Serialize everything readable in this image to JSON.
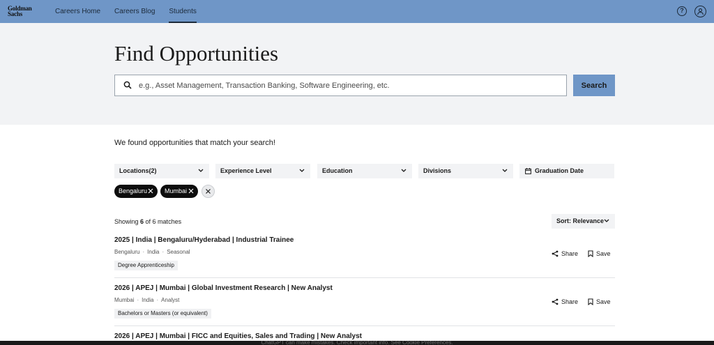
{
  "nav": {
    "logo_line1": "Goldman",
    "logo_line2": "Sachs",
    "links": [
      {
        "label": "Careers Home"
      },
      {
        "label": "Careers Blog"
      },
      {
        "label": "Students"
      }
    ],
    "help_glyph": "?"
  },
  "hero": {
    "title": "Find Opportunities",
    "search_placeholder": "e.g., Asset Management, Transaction Banking, Software Engineering, etc.",
    "search_value": "",
    "search_button": "Search"
  },
  "results": {
    "message": "We found opportunities that match your search!",
    "filters": [
      {
        "label": "Locations(2)"
      },
      {
        "label": "Experience Level"
      },
      {
        "label": "Education"
      },
      {
        "label": "Divisions"
      },
      {
        "label": "Graduation Date"
      }
    ],
    "chips": [
      {
        "label": "Bengaluru"
      },
      {
        "label": "Mumbai"
      }
    ],
    "showing_prefix": "Showing ",
    "showing_count": "6",
    "showing_suffix": " of 6 matches",
    "sort_label": "Sort: Relevance",
    "share_label": "Share",
    "save_label": "Save",
    "jobs": [
      {
        "title": "2025 | India | Bengaluru/Hyderabad | Industrial Trainee",
        "location": "Bengaluru",
        "country": "India",
        "type": "Seasonal",
        "tag": "Degree Apprenticeship"
      },
      {
        "title": "2026 | APEJ | Mumbai | Global Investment Research | New Analyst",
        "location": "Mumbai",
        "country": "India",
        "type": "Analyst",
        "tag": "Bachelors or Masters (or equivalent)"
      },
      {
        "title": "2026 | APEJ | Mumbai | FICC and Equities, Sales and Trading | New Analyst"
      }
    ]
  },
  "footer": {
    "note": "ChatGPT can make mistakes. Check important info. See Cookie Preferences."
  }
}
